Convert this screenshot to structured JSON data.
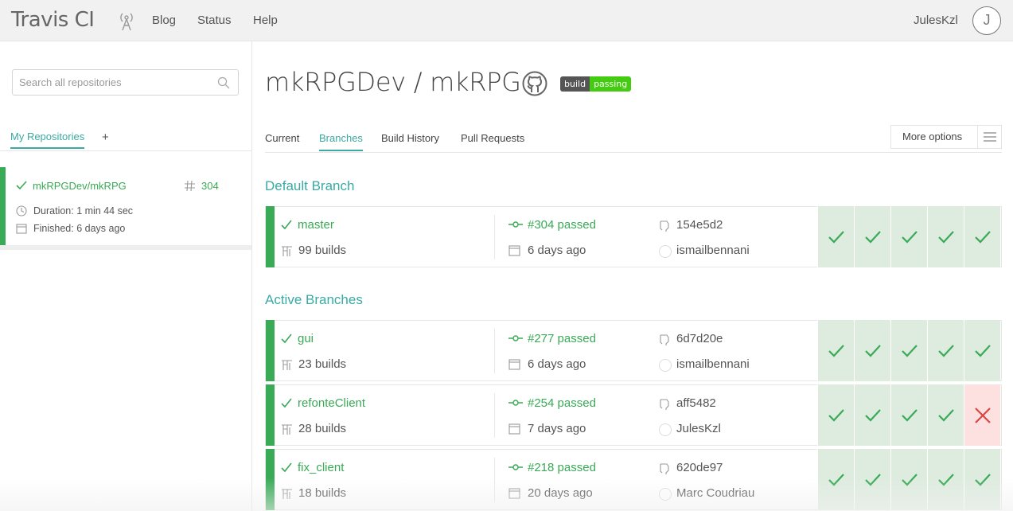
{
  "topbar": {
    "logo": "Travis CI",
    "nav": [
      "Blog",
      "Status",
      "Help"
    ],
    "username": "JulesKzl",
    "avatar_letter": "J"
  },
  "sidebar": {
    "search_placeholder": "Search all repositories",
    "tab_label": "My Repositories",
    "add_label": "+",
    "repo": {
      "name": "mkRPGDev/mkRPG",
      "build_number": "304",
      "duration": "Duration: 1 min 44 sec",
      "finished": "Finished: 6 days ago"
    }
  },
  "main": {
    "title": "mkRPGDev / mkRPG",
    "badge_left": "build",
    "badge_right": "passing",
    "tabs": [
      "Current",
      "Branches",
      "Build History",
      "Pull Requests"
    ],
    "more_options": "More options",
    "default_heading": "Default Branch",
    "active_heading": "Active Branches",
    "branches": [
      {
        "name": "master",
        "builds": "99 builds",
        "build": "#304 passed",
        "time": "6 days ago",
        "commit": "154e5d2",
        "author": "ismailbennani",
        "history": [
          "pass",
          "pass",
          "pass",
          "pass",
          "pass"
        ]
      },
      {
        "name": "gui",
        "builds": "23 builds",
        "build": "#277 passed",
        "time": "6 days ago",
        "commit": "6d7d20e",
        "author": "ismailbennani",
        "history": [
          "pass",
          "pass",
          "pass",
          "pass",
          "pass"
        ]
      },
      {
        "name": "refonteClient",
        "builds": "28 builds",
        "build": "#254 passed",
        "time": "7 days ago",
        "commit": "aff5482",
        "author": "JulesKzl",
        "history": [
          "pass",
          "pass",
          "pass",
          "pass",
          "fail"
        ]
      },
      {
        "name": "fix_client",
        "builds": "18 builds",
        "build": "#218 passed",
        "time": "20 days ago",
        "commit": "620de97",
        "author": "Marc Coudriau",
        "history": [
          "pass",
          "pass",
          "pass",
          "pass",
          "pass"
        ]
      }
    ]
  },
  "colors": {
    "accent": "#39aaa4",
    "pass": "#39aa56",
    "fail": "#db4545"
  }
}
